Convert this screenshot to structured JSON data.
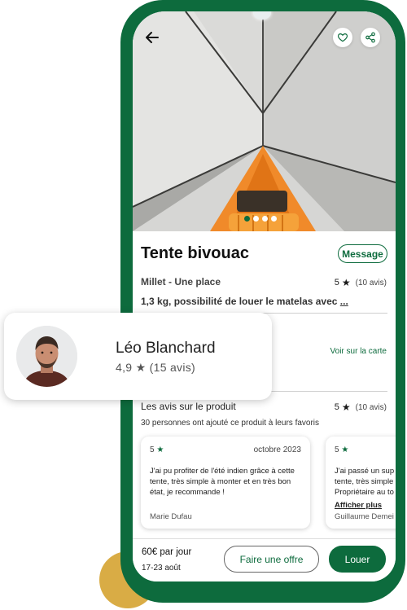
{
  "product": {
    "title": "Tente bivouac",
    "subtitle": "Millet - Une place",
    "rating": "5",
    "reviews_count": "(10 avis)",
    "description": "1,3 kg, possibilité de louer le matelas avec",
    "description_more": "...",
    "image_dots": {
      "total": 4,
      "active": 0
    }
  },
  "actions": {
    "message_label": "Message",
    "map_link": "Voir sur la carte"
  },
  "reviews": {
    "title": "Les avis sur le produit",
    "rating": "5",
    "count": "(10 avis)",
    "favorites_text": "30 personnes ont ajouté ce produit à leurs favoris",
    "items": [
      {
        "rating": "5",
        "date": "octobre 2023",
        "lines": [
          "J'ai pu profiter de l'été indien grâce à cette",
          "tente, très simple à monter et en très bon",
          "état, je recommande !"
        ],
        "author": "Marie Dufau"
      },
      {
        "rating": "5",
        "lines": [
          "J'ai passé un sup",
          "tente, très simple",
          "Propriétaire au to"
        ],
        "show_more": "Afficher plus",
        "author": "Guillaume Demei"
      }
    ]
  },
  "bottom_bar": {
    "price": "60€ par jour",
    "dates": "17-23 août",
    "offer_button": "Faire une offre",
    "rent_button": "Louer"
  },
  "owner": {
    "name": "Léo Blanchard",
    "rating": "4,9",
    "reviews": "(15 avis)"
  },
  "icons": {
    "back": "arrow-left-icon",
    "favorite": "heart-icon",
    "share": "share-icon",
    "star": "star-icon"
  },
  "colors": {
    "brand_green": "#0d6b3d",
    "accent_yellow": "#d9ac45",
    "tent_orange": "#f08a2a"
  }
}
